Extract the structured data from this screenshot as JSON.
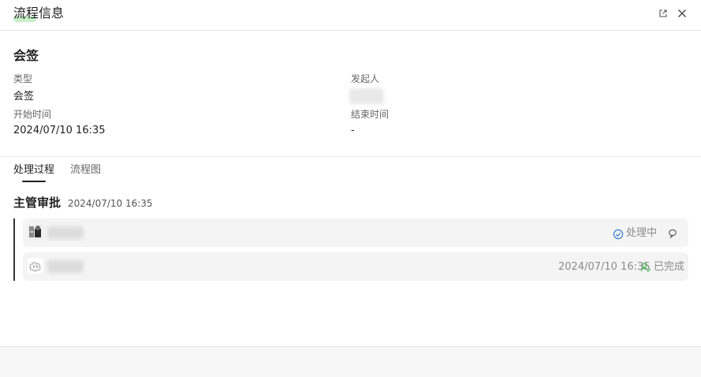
{
  "header": {
    "title": "流程信息",
    "open_icon": "external-link-icon",
    "close_icon": "close-icon"
  },
  "info": {
    "section_title": "会签",
    "fields": {
      "type_label": "类型",
      "type_value": "会签",
      "initiator_label": "发起人",
      "start_label": "开始时间",
      "start_value": "2024/07/10 16:35",
      "end_label": "结束时间",
      "end_value": "-"
    }
  },
  "tabs": [
    {
      "label": "处理过程",
      "active": true
    },
    {
      "label": "流程图",
      "active": false
    }
  ],
  "process": {
    "node_title": "主管审批",
    "node_time": "2024/07/10 16:35",
    "tasks": [
      {
        "status": "处理中",
        "status_icon": "check-circle-icon",
        "time": "",
        "action_icon": "comment-icon"
      },
      {
        "status": "已完成",
        "status_icon": "user-check-icon",
        "time": "2024/07/10 16:35"
      }
    ]
  },
  "colors": {
    "processing": "#3a7bd5",
    "completed": "#3fb950",
    "accent_underline": "#c8efc8"
  }
}
